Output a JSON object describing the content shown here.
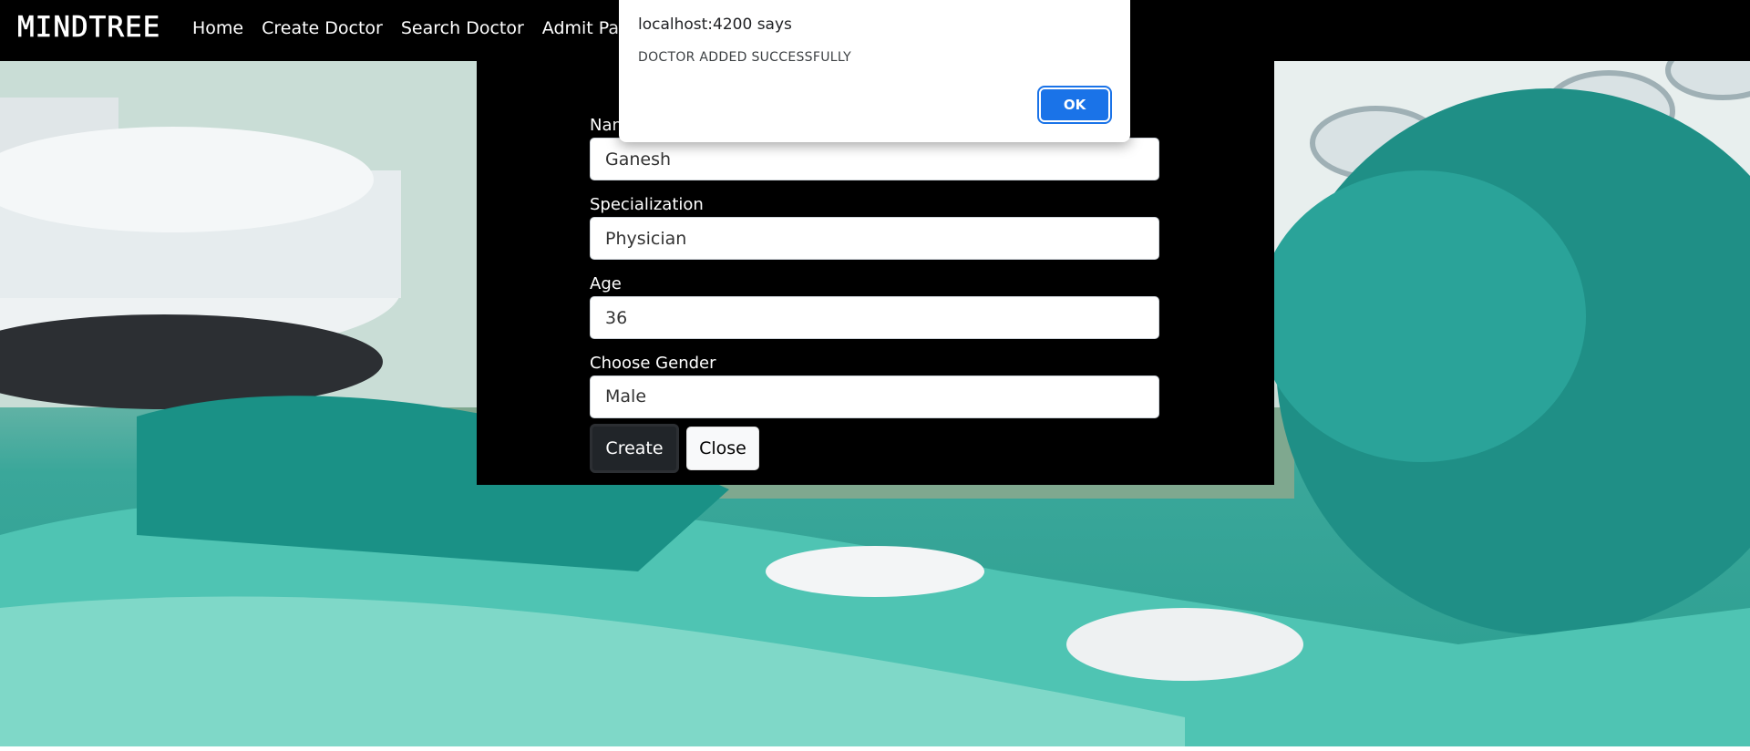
{
  "navbar": {
    "brand": "MINDTREE",
    "links": [
      {
        "label": "Home"
      },
      {
        "label": "Create Doctor"
      },
      {
        "label": "Search Doctor"
      },
      {
        "label": "Admit Patie"
      }
    ]
  },
  "form": {
    "name": {
      "label": "Name",
      "value": "Ganesh"
    },
    "specialization": {
      "label": "Specialization",
      "value": "Physician"
    },
    "age": {
      "label": "Age",
      "value": "36"
    },
    "gender": {
      "label": "Choose Gender",
      "value": "Male"
    },
    "create_label": "Create",
    "close_label": "Close"
  },
  "alert": {
    "title": "localhost:4200 says",
    "message": "DOCTOR ADDED SUCCESSFULLY",
    "ok_label": "OK"
  }
}
